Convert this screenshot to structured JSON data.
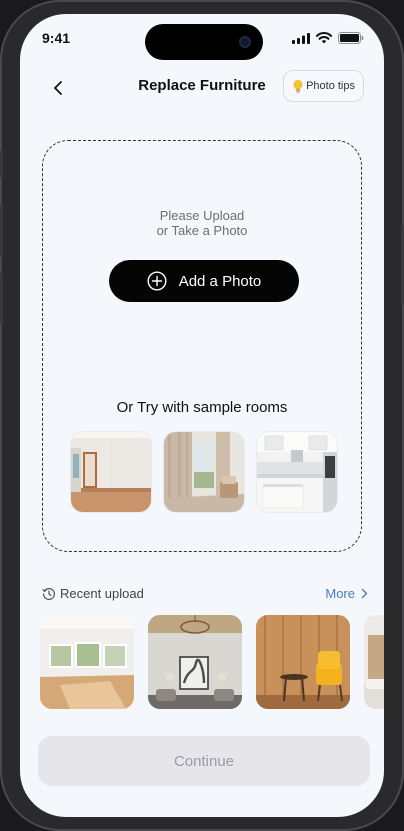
{
  "status_bar": {
    "time": "9:41"
  },
  "header": {
    "title": "Replace Furniture",
    "tips_label": "Photo tips"
  },
  "upload": {
    "prompt_line1": "Please Upload",
    "prompt_line2": "or Take a Photo",
    "add_button_label": "Add a Photo",
    "samples_heading": "Or Try with sample rooms"
  },
  "sample_rooms": [
    {
      "icon": "empty-room-image"
    },
    {
      "icon": "living-room-image"
    },
    {
      "icon": "kitchen-image"
    }
  ],
  "recent": {
    "label": "Recent upload",
    "more_label": "More"
  },
  "footer": {
    "continue_label": "Continue"
  },
  "colors": {
    "screen_bg": "#f4f7fb",
    "primary_button": "#050505",
    "link": "#4a7fbf",
    "disabled_button": "#e5e5ea",
    "disabled_text": "#9a9ca3"
  }
}
